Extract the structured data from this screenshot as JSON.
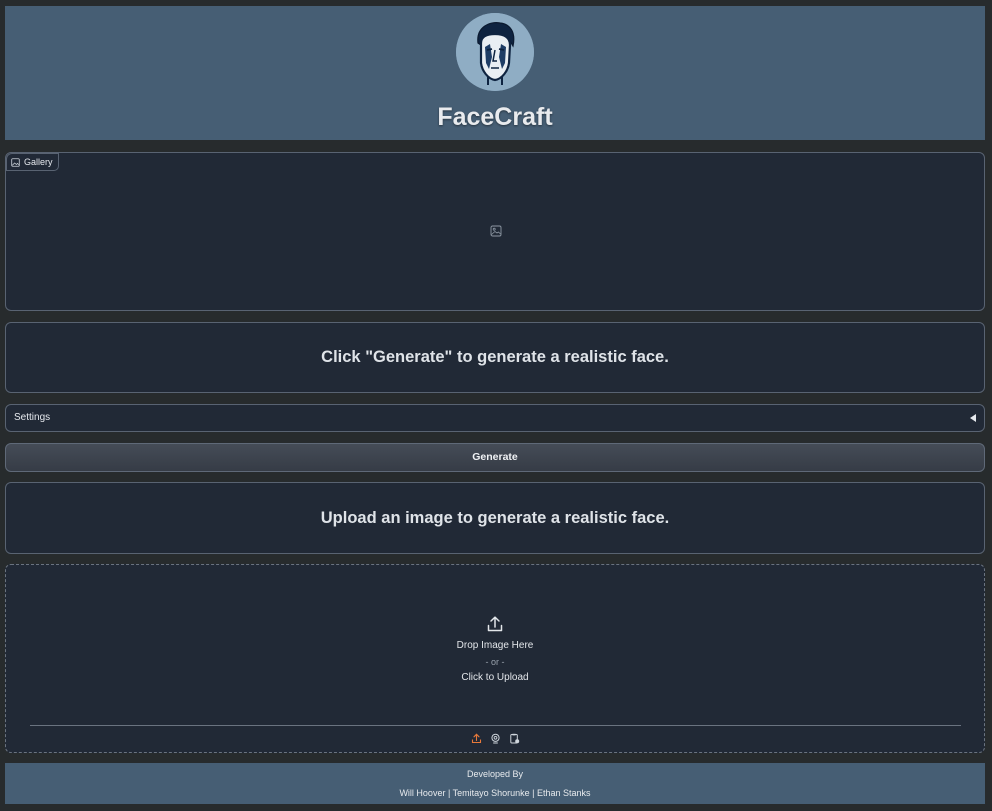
{
  "header": {
    "title": "FaceCraft",
    "logo_icon": "face-logo-icon"
  },
  "gallery": {
    "label": "Gallery",
    "empty_icon": "image-icon"
  },
  "generate_section": {
    "heading": "Click \"Generate\" to generate a realistic face."
  },
  "settings": {
    "label": "Settings",
    "collapsed": true
  },
  "generate_button": {
    "label": "Generate"
  },
  "upload_section": {
    "heading": "Upload an image to generate a realistic face."
  },
  "upload": {
    "drop_text": "Drop Image Here",
    "or_text": "- or -",
    "click_text": "Click to Upload",
    "sources": [
      "upload-icon",
      "webcam-icon",
      "clipboard-icon"
    ],
    "active_source_color": "#e8793a"
  },
  "footer": {
    "line1": "Developed By",
    "line2": "Will Hoover | Temitayo Shorunke | Ethan Stanks"
  },
  "colors": {
    "background": "#272b2d",
    "header_bg": "#465e74",
    "panel_bg": "#212936",
    "border": "#596372"
  }
}
